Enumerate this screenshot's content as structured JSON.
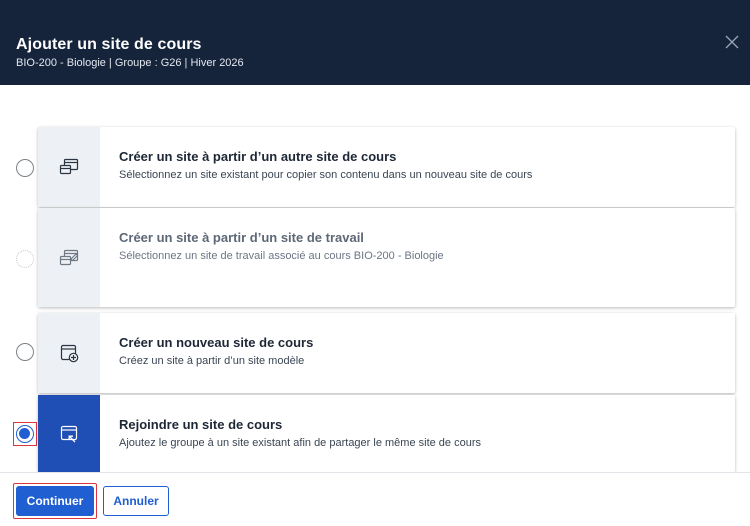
{
  "dialog": {
    "title": "Ajouter un site de cours",
    "subtitle": "BIO-200 - Biologie | Groupe : G26 | Hiver 2026"
  },
  "options": [
    {
      "title": "Créer un site à partir d’un autre site de cours",
      "description": "Sélectionnez un site existant pour copier son contenu dans un nouveau site de cours",
      "icon": "copy-site-icon",
      "state": "unchecked"
    },
    {
      "title": "Créer un site à partir d’un site de travail",
      "description": "Sélectionnez un site de travail associé au cours BIO-200 - Biologie",
      "icon": "work-site-icon",
      "state": "disabled"
    },
    {
      "title": "Créer un nouveau site de cours",
      "description": "Créez un site à partir d’un site modèle",
      "icon": "new-site-icon",
      "state": "unchecked"
    },
    {
      "title": "Rejoindre un site de cours",
      "description": "Ajoutez le groupe à un site existant afin de partager le même site de cours",
      "icon": "join-site-icon",
      "state": "checked"
    }
  ],
  "footer": {
    "continue_label": "Continuer",
    "cancel_label": "Annuler"
  },
  "colors": {
    "header_bg": "#15233b",
    "primary": "#1f5fd1",
    "selected_icon_bg": "#1f4fb5",
    "icon_bg": "#edf0f4",
    "focus_ring": "#d9363e"
  }
}
